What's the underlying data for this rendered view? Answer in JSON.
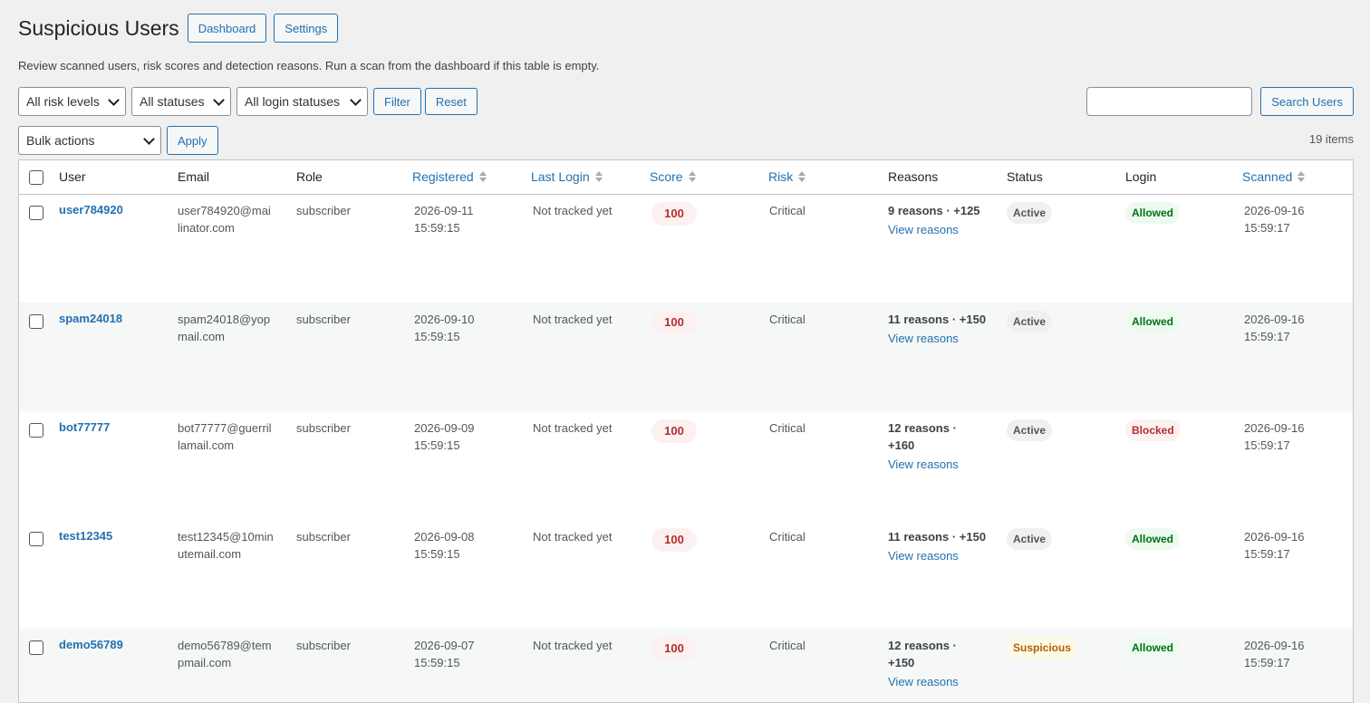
{
  "page": {
    "title": "Suspicious Users",
    "dashboard_button": "Dashboard",
    "settings_button": "Settings",
    "description": "Review scanned users, risk scores and detection reasons. Run a scan from the dashboard if this table is empty."
  },
  "filters": {
    "risk_levels": "All risk levels",
    "statuses": "All statuses",
    "login_statuses": "All login statuses",
    "filter_button": "Filter",
    "reset_button": "Reset"
  },
  "search": {
    "value": "",
    "button": "Search Users"
  },
  "bulk": {
    "selected": "Bulk actions",
    "apply_button": "Apply"
  },
  "items_count": "19 items",
  "columns": {
    "user": "User",
    "email": "Email",
    "role": "Role",
    "registered": "Registered",
    "last_login": "Last Login",
    "score": "Score",
    "risk": "Risk",
    "reasons": "Reasons",
    "status": "Status",
    "login": "Login",
    "scanned": "Scanned"
  },
  "view_reasons_label": "View reasons",
  "rows": [
    {
      "user": "user784920",
      "email_line1": "user784920@mai",
      "email_line2": "linator.com",
      "role": "subscriber",
      "registered_date": "2026-09-11",
      "registered_time": "15:59:15",
      "last_login": "Not tracked yet",
      "score": "100",
      "risk": "Critical",
      "reasons_line1": "9 reasons · +125",
      "reasons_line2": "",
      "status": "Active",
      "login": "Allowed",
      "scanned_date": "2026-09-16",
      "scanned_time": "15:59:17"
    },
    {
      "user": "spam24018",
      "email_line1": "spam24018@yop",
      "email_line2": "mail.com",
      "role": "subscriber",
      "registered_date": "2026-09-10",
      "registered_time": "15:59:15",
      "last_login": "Not tracked yet",
      "score": "100",
      "risk": "Critical",
      "reasons_line1": "11 reasons · +150",
      "reasons_line2": "",
      "status": "Active",
      "login": "Allowed",
      "scanned_date": "2026-09-16",
      "scanned_time": "15:59:17"
    },
    {
      "user": "bot77777",
      "email_line1": "bot77777@guerril",
      "email_line2": "lamail.com",
      "role": "subscriber",
      "registered_date": "2026-09-09",
      "registered_time": "15:59:15",
      "last_login": "Not tracked yet",
      "score": "100",
      "risk": "Critical",
      "reasons_line1": "12 reasons ·",
      "reasons_line2": "+160",
      "status": "Active",
      "login": "Blocked",
      "scanned_date": "2026-09-16",
      "scanned_time": "15:59:17"
    },
    {
      "user": "test12345",
      "email_line1": "test12345@10min",
      "email_line2": "utemail.com",
      "role": "subscriber",
      "registered_date": "2026-09-08",
      "registered_time": "15:59:15",
      "last_login": "Not tracked yet",
      "score": "100",
      "risk": "Critical",
      "reasons_line1": "11 reasons · +150",
      "reasons_line2": "",
      "status": "Active",
      "login": "Allowed",
      "scanned_date": "2026-09-16",
      "scanned_time": "15:59:17"
    },
    {
      "user": "demo56789",
      "email_line1": "demo56789@tem",
      "email_line2": "pmail.com",
      "role": "subscriber",
      "registered_date": "2026-09-07",
      "registered_time": "15:59:15",
      "last_login": "Not tracked yet",
      "score": "100",
      "risk": "Critical",
      "reasons_line1": "12 reasons ·",
      "reasons_line2": "+150",
      "status": "Suspicious",
      "login": "Allowed",
      "scanned_date": "2026-09-16",
      "scanned_time": "15:59:17"
    }
  ]
}
